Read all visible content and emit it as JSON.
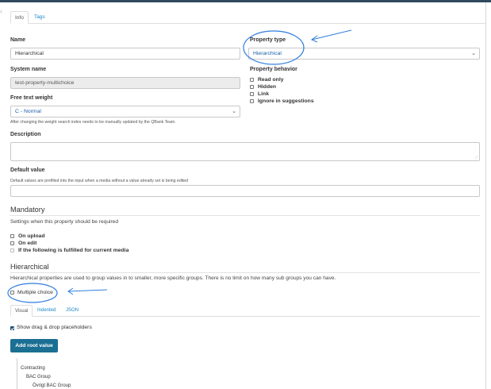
{
  "tabs": [
    "Info",
    "Tags"
  ],
  "name": {
    "label": "Name",
    "value": "Hierarchical"
  },
  "property_type": {
    "label": "Property type",
    "value": "Hierarchical"
  },
  "system_name": {
    "label": "System name",
    "value": "test-property-multichoice"
  },
  "property_behavior": {
    "label": "Property behavior",
    "options": [
      {
        "label": "Read only",
        "checked": false
      },
      {
        "label": "Hidden",
        "checked": false
      },
      {
        "label": "Link",
        "checked": false
      },
      {
        "label": "Ignore in suggestions",
        "checked": false
      }
    ]
  },
  "free_text_weight": {
    "label": "Free text weight",
    "value": "C - Normal",
    "help": "After changing the weight search index needs to be manually updated by the QBank Team."
  },
  "description": {
    "label": "Description",
    "value": ""
  },
  "default_value": {
    "label": "Default value",
    "help": "Default values are prefilled into the input when a media without a value already set is being edited",
    "value": ""
  },
  "mandatory": {
    "title": "Mandatory",
    "description": "Settings when this property should be required",
    "options": [
      {
        "label": "On upload",
        "checked": false
      },
      {
        "label": "On edit",
        "checked": false
      },
      {
        "label": "If the following is fulfilled for current media",
        "checked": false
      }
    ]
  },
  "hierarchical": {
    "title": "Hierarchical",
    "description": "Hierarchical properties are used to group values in to smaller, more specific groups. There is no limit on how many sub groups you can have.",
    "multiple_choice": {
      "label": "Multiple choice",
      "checked": false
    },
    "view_tabs": [
      "Visual",
      "Indented",
      "JSON"
    ],
    "show_placeholders": {
      "label": "Show drag & drop placeholders",
      "checked": true
    },
    "add_root_label": "Add root value",
    "tree": [
      "Contracting",
      "BAC Group",
      "Övrigt BAC Group"
    ]
  },
  "icons": {
    "select_caret": "chevron-down-icon",
    "edge": "chevron-left-icon"
  },
  "colors": {
    "annotation": "#2f7de0",
    "button": "#1a6f93",
    "link": "#1a87c9",
    "topbar": "#2f4a5e"
  }
}
